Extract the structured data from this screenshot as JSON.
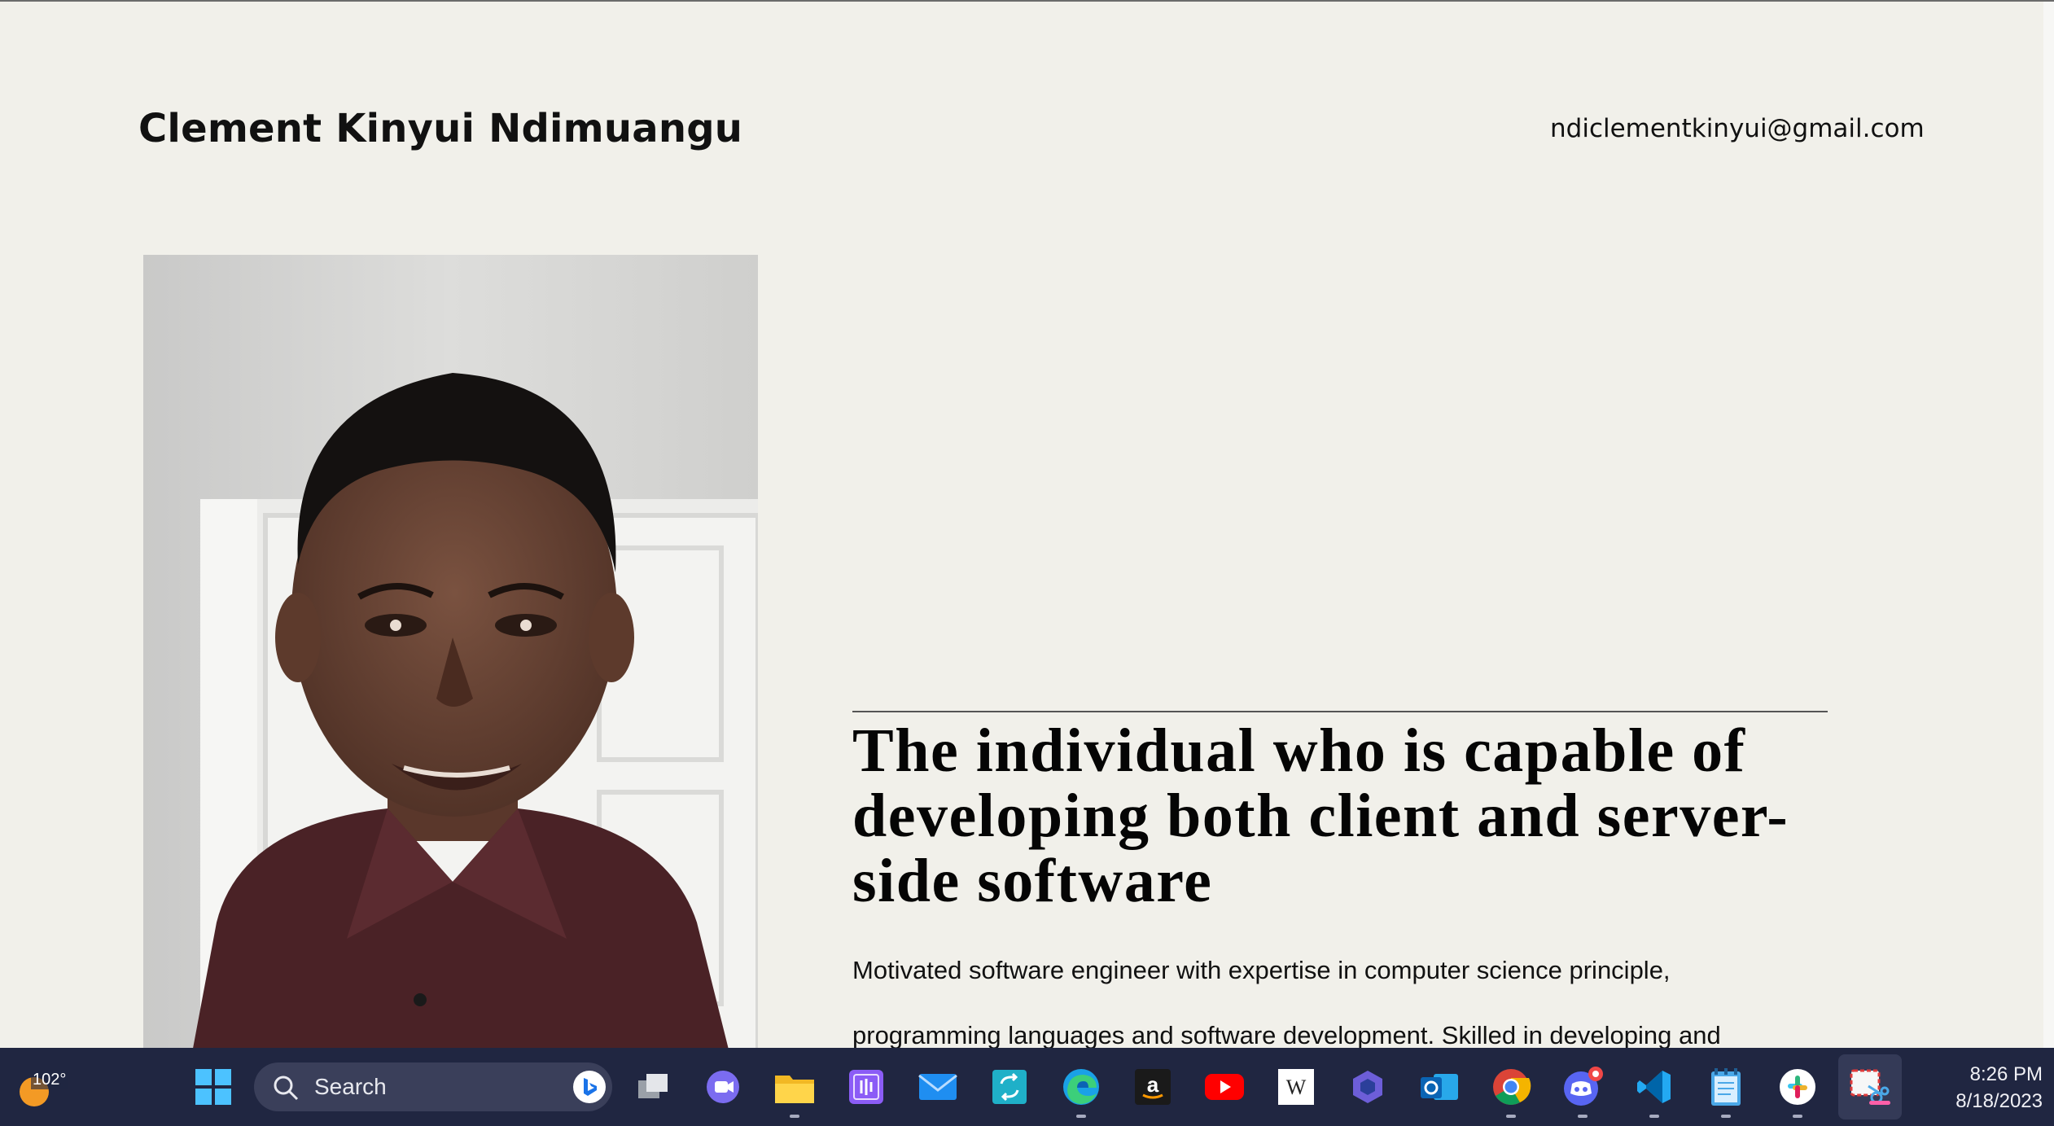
{
  "header": {
    "name": "Clement Kinyui Ndimuangu",
    "email": "ndiclementkinyui@gmail.com"
  },
  "hero": {
    "title": "The individual who is capable of developing both client and server-side software",
    "description_line1": "Motivated software engineer with expertise in computer science principle,",
    "description_line2": "programming languages and software development. Skilled in developing and"
  },
  "taskbar": {
    "weather_temp": "102°",
    "search_label": "Search",
    "time": "8:26 PM",
    "date": "8/18/2023",
    "apps": [
      "start-icon",
      "task-view-icon",
      "teams-chat-icon",
      "file-explorer-icon",
      "widgets-app-icon",
      "mail-icon",
      "sync-app-icon",
      "edge-icon",
      "amazon-icon",
      "youtube-icon",
      "wikipedia-icon",
      "copilot-icon",
      "outlook-icon",
      "chrome-icon",
      "discord-icon",
      "vscode-icon",
      "notepad-icon",
      "slack-icon",
      "snipping-tool-icon"
    ]
  },
  "colors": {
    "page_background": "#f1f0ea",
    "taskbar_background": "#202641",
    "shirt": "#4a2226"
  }
}
